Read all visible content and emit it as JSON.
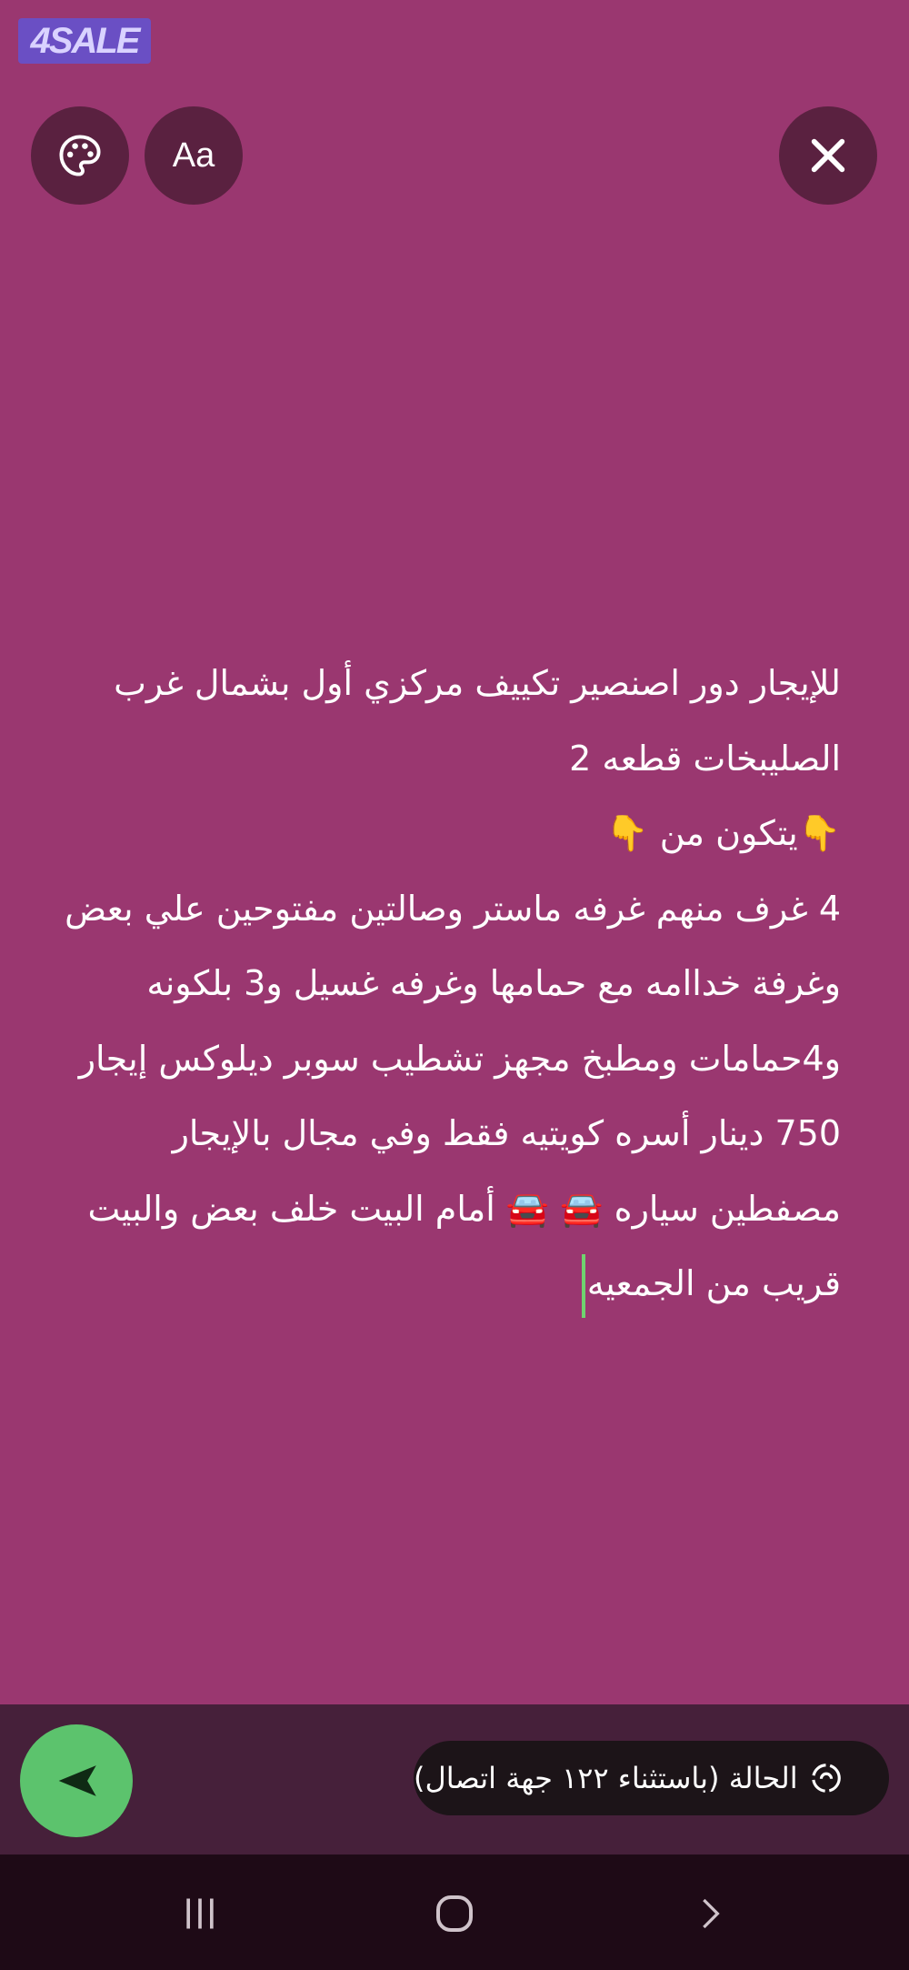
{
  "app": {
    "logo_text": "4SALE"
  },
  "toolbar": {
    "palette_icon": "palette-icon",
    "font_label": "Aa",
    "close_icon": "close-icon"
  },
  "story": {
    "lines": [
      "للإيجار دور اصنصير تكييف مركزي أول بشمال غرب",
      "الصليبخات قطعه 2",
      "👇يتكون من 👇",
      "4 غرف منهم غرفه ماستر وصالتين مفتوحين علي بعض",
      "وغرفة خداامه مع حمامها وغرفه غسيل و3 بلكونه",
      "و4حمامات ومطبخ مجهز تشطيب سوبر ديلوكس إيجار",
      "750 دينار أسره كويتيه فقط وفي مجال بالإيجار",
      "مصفطين سياره 🚘 🚘 أمام البيت خلف بعض والبيت",
      "قريب من الجمعيه"
    ]
  },
  "composer": {
    "status_text": "الحالة (باستثناء ١٢٢ جهة اتصال)",
    "status_icon": "status-icon",
    "send_icon": "send-icon"
  },
  "navigation": {
    "recents_icon": "recents-icon",
    "home_icon": "home-icon",
    "back_icon": "back-icon"
  },
  "colors": {
    "background": "#9a3770",
    "send_button": "#5cc36d",
    "cursor": "#6fd36f"
  }
}
